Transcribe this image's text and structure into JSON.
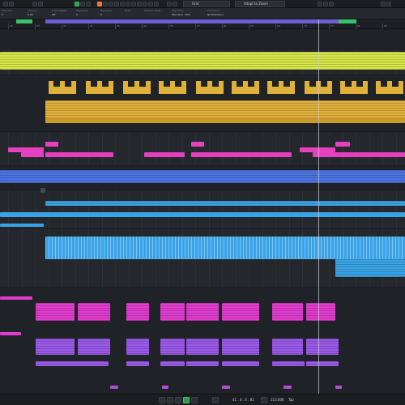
{
  "toolbar": {
    "snap_type": "Grid",
    "quantize": "Adapt to Zoom"
  },
  "infoline": {
    "cells": [
      {
        "label": "Fade Out",
        "value": "0"
      },
      {
        "label": "Volume",
        "value": "0.00"
      },
      {
        "label": "Event Phase",
        "value": "Off"
      },
      {
        "label": "Transpose",
        "value": "0"
      },
      {
        "label": "Fine-Tune",
        "value": "0"
      },
      {
        "label": "Mute",
        "value": ""
      },
      {
        "label": "Musical Mode",
        "value": ""
      },
      {
        "label": "Algorithm",
        "value": "Standard - Solo"
      },
      {
        "label": "Extension",
        "value": "No Extension"
      }
    ]
  },
  "ruler": {
    "bars": [
      "29",
      "33",
      "37",
      "41",
      "45",
      "49",
      "53",
      "57",
      "61",
      "65",
      "69",
      "73",
      "77",
      "81",
      "85"
    ]
  },
  "transport": {
    "position": "41 . 4 . 4 . 81",
    "tempo": "113.000",
    "tap": "Tap"
  },
  "colors": {
    "yellow": "#d8e64a",
    "gold": "#e0b13a",
    "pink": "#e640c0",
    "blue": "#4c74e0",
    "cyan": "#3aa3e6",
    "magenta": "#e23ccf",
    "purple": "#9a5ae8",
    "loop": "#6f5fd6",
    "cycle": "#38c26a"
  }
}
